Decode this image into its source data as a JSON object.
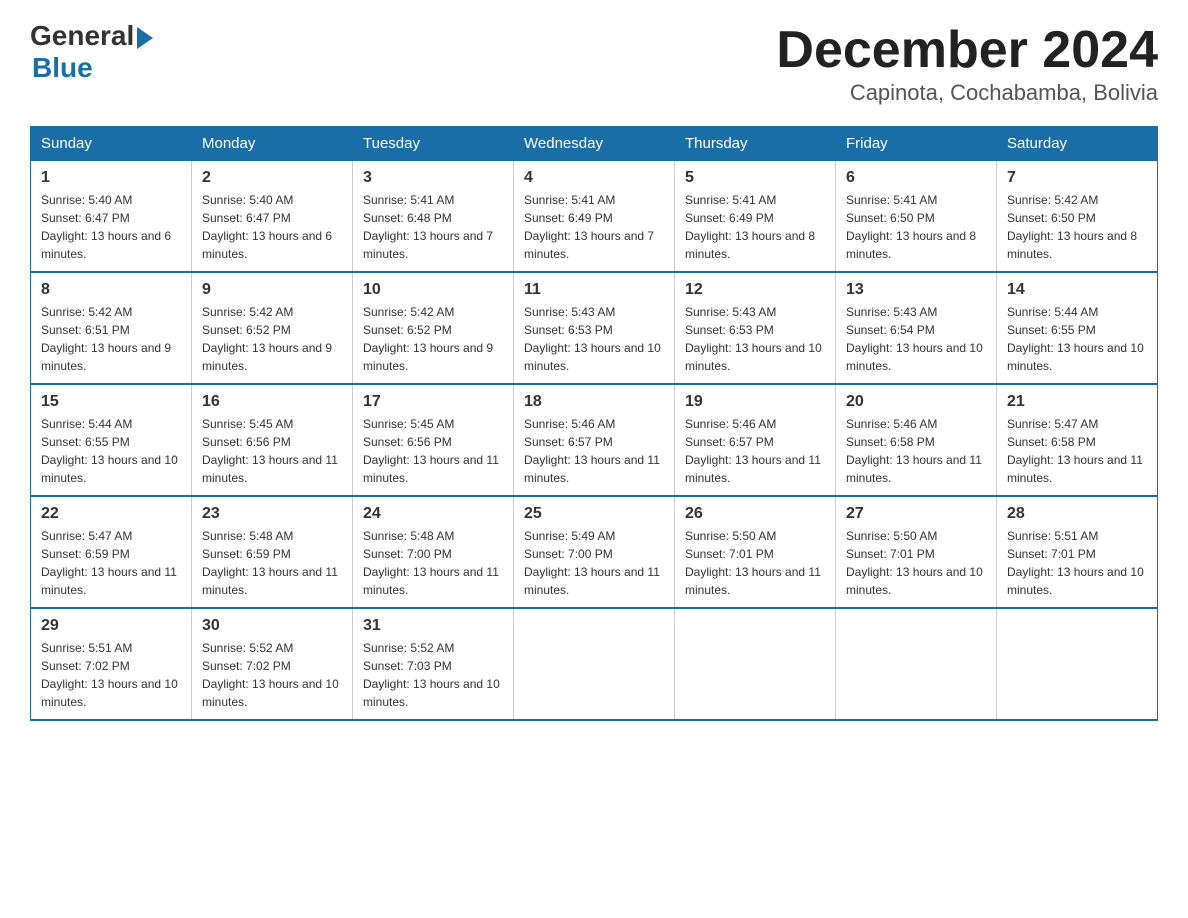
{
  "header": {
    "logo": {
      "general": "General",
      "arrow": "▶",
      "blue": "Blue"
    },
    "title": "December 2024",
    "subtitle": "Capinota, Cochabamba, Bolivia"
  },
  "days_of_week": [
    "Sunday",
    "Monday",
    "Tuesday",
    "Wednesday",
    "Thursday",
    "Friday",
    "Saturday"
  ],
  "weeks": [
    [
      {
        "day": "1",
        "sunrise": "5:40 AM",
        "sunset": "6:47 PM",
        "daylight": "13 hours and 6 minutes."
      },
      {
        "day": "2",
        "sunrise": "5:40 AM",
        "sunset": "6:47 PM",
        "daylight": "13 hours and 6 minutes."
      },
      {
        "day": "3",
        "sunrise": "5:41 AM",
        "sunset": "6:48 PM",
        "daylight": "13 hours and 7 minutes."
      },
      {
        "day": "4",
        "sunrise": "5:41 AM",
        "sunset": "6:49 PM",
        "daylight": "13 hours and 7 minutes."
      },
      {
        "day": "5",
        "sunrise": "5:41 AM",
        "sunset": "6:49 PM",
        "daylight": "13 hours and 8 minutes."
      },
      {
        "day": "6",
        "sunrise": "5:41 AM",
        "sunset": "6:50 PM",
        "daylight": "13 hours and 8 minutes."
      },
      {
        "day": "7",
        "sunrise": "5:42 AM",
        "sunset": "6:50 PM",
        "daylight": "13 hours and 8 minutes."
      }
    ],
    [
      {
        "day": "8",
        "sunrise": "5:42 AM",
        "sunset": "6:51 PM",
        "daylight": "13 hours and 9 minutes."
      },
      {
        "day": "9",
        "sunrise": "5:42 AM",
        "sunset": "6:52 PM",
        "daylight": "13 hours and 9 minutes."
      },
      {
        "day": "10",
        "sunrise": "5:42 AM",
        "sunset": "6:52 PM",
        "daylight": "13 hours and 9 minutes."
      },
      {
        "day": "11",
        "sunrise": "5:43 AM",
        "sunset": "6:53 PM",
        "daylight": "13 hours and 10 minutes."
      },
      {
        "day": "12",
        "sunrise": "5:43 AM",
        "sunset": "6:53 PM",
        "daylight": "13 hours and 10 minutes."
      },
      {
        "day": "13",
        "sunrise": "5:43 AM",
        "sunset": "6:54 PM",
        "daylight": "13 hours and 10 minutes."
      },
      {
        "day": "14",
        "sunrise": "5:44 AM",
        "sunset": "6:55 PM",
        "daylight": "13 hours and 10 minutes."
      }
    ],
    [
      {
        "day": "15",
        "sunrise": "5:44 AM",
        "sunset": "6:55 PM",
        "daylight": "13 hours and 10 minutes."
      },
      {
        "day": "16",
        "sunrise": "5:45 AM",
        "sunset": "6:56 PM",
        "daylight": "13 hours and 11 minutes."
      },
      {
        "day": "17",
        "sunrise": "5:45 AM",
        "sunset": "6:56 PM",
        "daylight": "13 hours and 11 minutes."
      },
      {
        "day": "18",
        "sunrise": "5:46 AM",
        "sunset": "6:57 PM",
        "daylight": "13 hours and 11 minutes."
      },
      {
        "day": "19",
        "sunrise": "5:46 AM",
        "sunset": "6:57 PM",
        "daylight": "13 hours and 11 minutes."
      },
      {
        "day": "20",
        "sunrise": "5:46 AM",
        "sunset": "6:58 PM",
        "daylight": "13 hours and 11 minutes."
      },
      {
        "day": "21",
        "sunrise": "5:47 AM",
        "sunset": "6:58 PM",
        "daylight": "13 hours and 11 minutes."
      }
    ],
    [
      {
        "day": "22",
        "sunrise": "5:47 AM",
        "sunset": "6:59 PM",
        "daylight": "13 hours and 11 minutes."
      },
      {
        "day": "23",
        "sunrise": "5:48 AM",
        "sunset": "6:59 PM",
        "daylight": "13 hours and 11 minutes."
      },
      {
        "day": "24",
        "sunrise": "5:48 AM",
        "sunset": "7:00 PM",
        "daylight": "13 hours and 11 minutes."
      },
      {
        "day": "25",
        "sunrise": "5:49 AM",
        "sunset": "7:00 PM",
        "daylight": "13 hours and 11 minutes."
      },
      {
        "day": "26",
        "sunrise": "5:50 AM",
        "sunset": "7:01 PM",
        "daylight": "13 hours and 11 minutes."
      },
      {
        "day": "27",
        "sunrise": "5:50 AM",
        "sunset": "7:01 PM",
        "daylight": "13 hours and 10 minutes."
      },
      {
        "day": "28",
        "sunrise": "5:51 AM",
        "sunset": "7:01 PM",
        "daylight": "13 hours and 10 minutes."
      }
    ],
    [
      {
        "day": "29",
        "sunrise": "5:51 AM",
        "sunset": "7:02 PM",
        "daylight": "13 hours and 10 minutes."
      },
      {
        "day": "30",
        "sunrise": "5:52 AM",
        "sunset": "7:02 PM",
        "daylight": "13 hours and 10 minutes."
      },
      {
        "day": "31",
        "sunrise": "5:52 AM",
        "sunset": "7:03 PM",
        "daylight": "13 hours and 10 minutes."
      },
      {
        "day": "",
        "sunrise": "",
        "sunset": "",
        "daylight": ""
      },
      {
        "day": "",
        "sunrise": "",
        "sunset": "",
        "daylight": ""
      },
      {
        "day": "",
        "sunrise": "",
        "sunset": "",
        "daylight": ""
      },
      {
        "day": "",
        "sunrise": "",
        "sunset": "",
        "daylight": ""
      }
    ]
  ]
}
